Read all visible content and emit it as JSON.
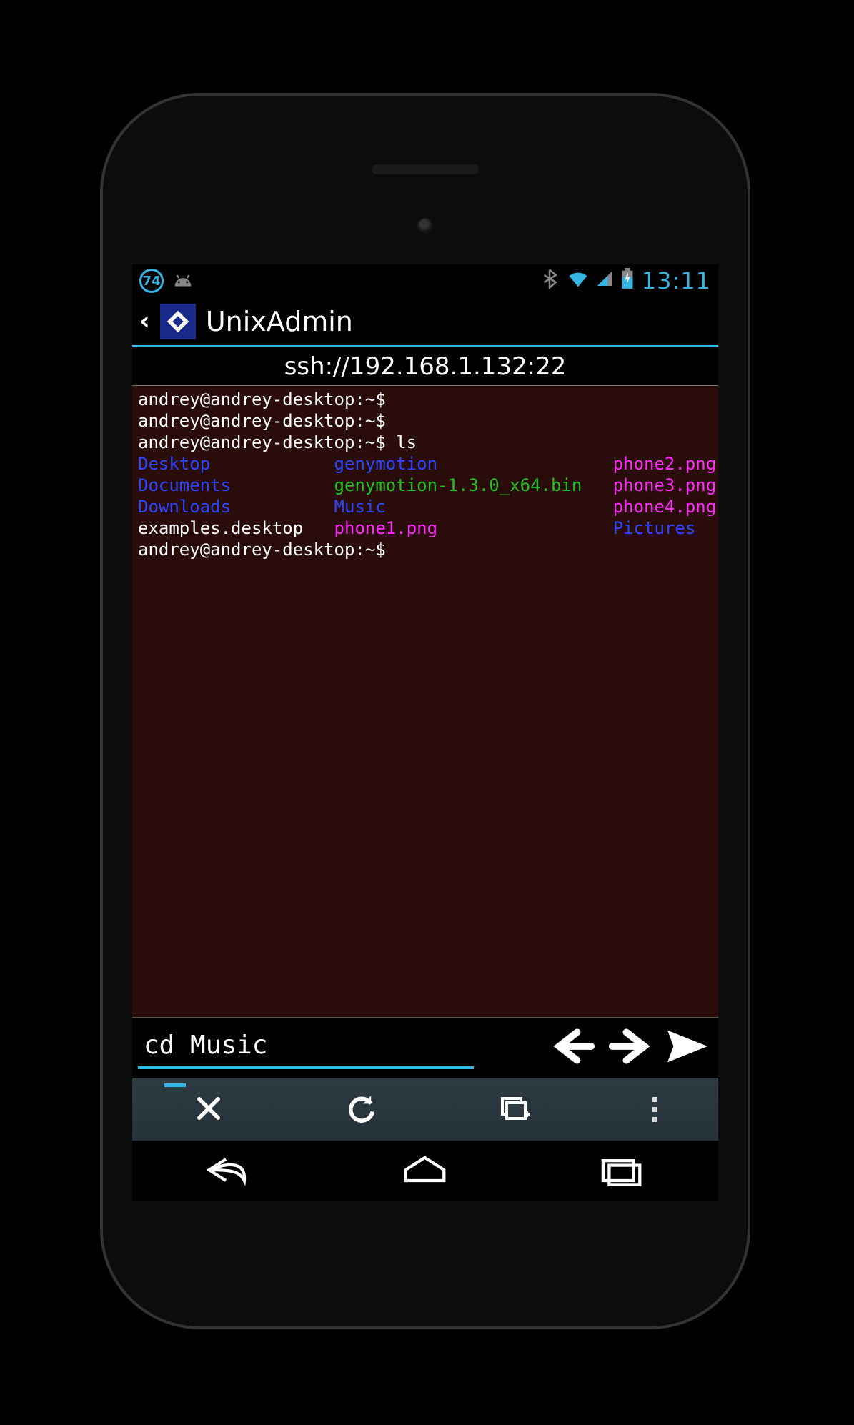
{
  "statusbar": {
    "battery_level": "74",
    "clock": "13:11"
  },
  "titlebar": {
    "app_name": "UnixAdmin"
  },
  "connection": {
    "url": "ssh://192.168.1.132:22"
  },
  "terminal": {
    "prompt": "andrey@andrey-desktop:~$",
    "lines": [
      {
        "prompt": "andrey@andrey-desktop:~$",
        "cmd": ""
      },
      {
        "prompt": "andrey@andrey-desktop:~$",
        "cmd": ""
      },
      {
        "prompt": "andrey@andrey-desktop:~$",
        "cmd": "ls"
      }
    ],
    "ls_rows": [
      {
        "c1": {
          "t": "Desktop",
          "cls": "blue"
        },
        "c2": {
          "t": "genymotion",
          "cls": "blue"
        },
        "c3": {
          "t": "phone2.png",
          "cls": "mag"
        }
      },
      {
        "c1": {
          "t": "Documents",
          "cls": "blue"
        },
        "c2": {
          "t": "genymotion-1.3.0_x64.bin",
          "cls": "green"
        },
        "c3": {
          "t": "phone3.png",
          "cls": "mag"
        }
      },
      {
        "c1": {
          "t": "Downloads",
          "cls": "blue"
        },
        "c2": {
          "t": "Music",
          "cls": "blue"
        },
        "c3": {
          "t": "phone4.png",
          "cls": "mag"
        }
      },
      {
        "c1": {
          "t": "examples.desktop",
          "cls": "white"
        },
        "c2": {
          "t": "phone1.png",
          "cls": "mag"
        },
        "c3": {
          "t": "Pictures",
          "cls": "blue"
        }
      }
    ],
    "after_prompt": "andrey@andrey-desktop:~$"
  },
  "input": {
    "value": "cd Music"
  },
  "icons": {
    "battery_badge": "battery-level-badge",
    "android": "android-icon",
    "bluetooth": "bluetooth-icon",
    "wifi": "wifi-icon",
    "cell": "cell-signal-icon",
    "battery": "battery-charging-icon",
    "back": "back-chevron-icon",
    "app_logo": "app-logo-icon",
    "arrow_left": "history-prev-icon",
    "arrow_right": "history-next-icon",
    "send": "send-icon",
    "close": "close-icon",
    "refresh": "refresh-icon",
    "new_tab": "new-session-icon",
    "overflow": "overflow-menu-icon",
    "nav_back": "nav-back-icon",
    "nav_home": "nav-home-icon",
    "nav_recent": "nav-recent-icon"
  }
}
